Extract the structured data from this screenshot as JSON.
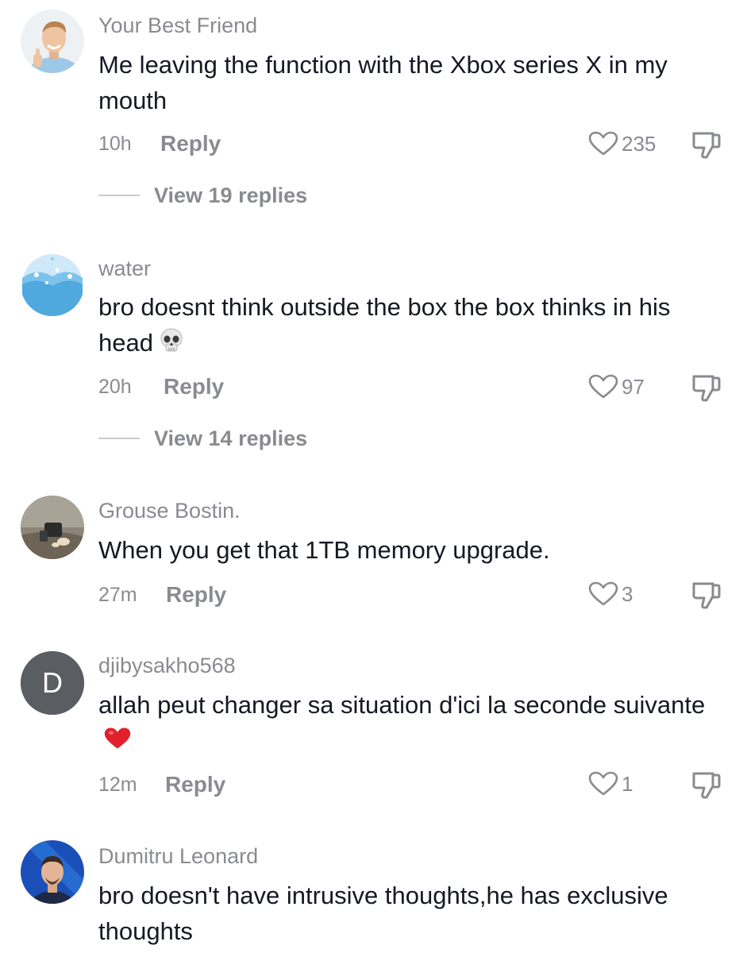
{
  "comments": [
    {
      "username": "Your Best Friend",
      "text": "Me leaving the function with the Xbox series X in my mouth",
      "time": "10h",
      "reply_label": "Reply",
      "likes": "235",
      "view_replies": "View 19 replies",
      "avatar": "man-thumbs-up-photo"
    },
    {
      "username": "water",
      "text": "bro doesnt think outside the box the box thinks in his head",
      "emoji": "skull-emoji",
      "time": "20h",
      "reply_label": "Reply",
      "likes": "97",
      "view_replies": "View 14 replies",
      "avatar": "water-splash-photo"
    },
    {
      "username": "Grouse Bostin.",
      "text": "When you get that 1TB memory upgrade.",
      "time": "27m",
      "reply_label": "Reply",
      "likes": "3",
      "avatar": "object-photo"
    },
    {
      "username": "djibysakho568",
      "text": "allah peut changer sa situation d'ici la seconde suivante",
      "emoji": "red-heart-emoji",
      "time": "12m",
      "reply_label": "Reply",
      "likes": "1",
      "avatar": "letter-avatar",
      "avatar_letter": "D"
    },
    {
      "username": "Dumitru Leonard",
      "text": "bro doesn't have intrusive thoughts,he has exclusive thoughts",
      "avatar": "man-blue-background-photo"
    }
  ],
  "colors": {
    "text": "#161823",
    "secondary": "#8a8b91",
    "letter_avatar_bg": "#5a5d61"
  }
}
